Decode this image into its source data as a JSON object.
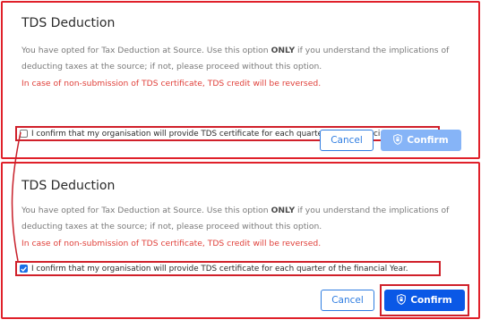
{
  "dialogs": [
    {
      "title": "TDS Deduction",
      "desc_part1": "You have opted for Tax Deduction at Source. Use this option ",
      "desc_bold": "ONLY",
      "desc_part2": " if you understand the implications of deducting taxes at the source; if not, please proceed without this option.",
      "warning": "In case of non-submission of TDS certificate, TDS credit will be reversed.",
      "checkbox_label": "I confirm that my organisation will provide TDS certificate for each quarter of the financial Year.",
      "checked": false,
      "cancel_label": "Cancel",
      "confirm_label": "Confirm",
      "confirm_state": "disabled"
    },
    {
      "title": "TDS Deduction",
      "desc_part1": "You have opted for Tax Deduction at Source. Use this option ",
      "desc_bold": "ONLY",
      "desc_part2": " if you understand the implications of deducting taxes at the source; if not, please proceed without this option.",
      "warning": "In case of non-submission of TDS certificate, TDS credit will be reversed.",
      "checkbox_label": "I confirm that my organisation will provide TDS certificate for each quarter of the financial Year.",
      "checked": true,
      "cancel_label": "Cancel",
      "confirm_label": "Confirm",
      "confirm_state": "enabled"
    }
  ],
  "colors": {
    "annotation_red": "#d0202a",
    "primary_blue": "#0a58e6",
    "disabled_blue": "#86b4f7",
    "warning_red": "#e0403a"
  }
}
